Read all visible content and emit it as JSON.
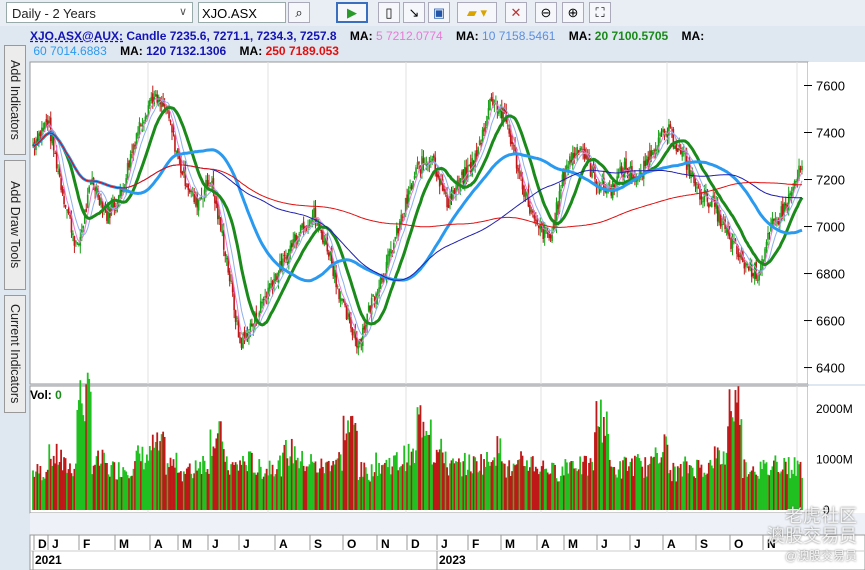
{
  "toolbar": {
    "period": "Daily - 2 Years",
    "symbol": "XJO.ASX",
    "icons": [
      "search-icon",
      "play-icon",
      "new-icon",
      "export-icon",
      "save-icon",
      "open-folder-icon",
      "tools-icon",
      "zoom-out-icon",
      "zoom-in-icon",
      "fit-icon"
    ]
  },
  "side_tabs": [
    "Add Indicators",
    "Add Draw Tools",
    "Current Indicators"
  ],
  "info": {
    "series": "XJO.ASX@AUX:",
    "candle": "Candle 7235.6, 7271.1, 7234.3, 7257.8",
    "ma": [
      {
        "label": "MA:",
        "value": "5 7212.0774",
        "color": "#e879d6"
      },
      {
        "label": "MA:",
        "value": "10 7158.5461",
        "color": "#5b8fe0"
      },
      {
        "label": "MA:",
        "value": "20 7100.5705",
        "color": "#1a8a1a"
      },
      {
        "label": "MA:",
        "value": "60 7014.6883",
        "color": "#2a9af0"
      },
      {
        "label": "MA:",
        "value": "120 7132.1306",
        "color": "#1414b4"
      },
      {
        "label": "MA:",
        "value": "250 7189.053",
        "color": "#e01010"
      }
    ]
  },
  "volume_label": "Vol:",
  "volume_value": "0",
  "watermark": [
    "老虎社区",
    "澳股交易员",
    "@澳股交易员"
  ],
  "chart_data": {
    "type": "candlestick",
    "price_ticks": [
      6400,
      6600,
      6800,
      7000,
      7200,
      7400,
      7600
    ],
    "ylim": [
      6330,
      7700
    ],
    "volume_ticks": [
      "0",
      "1000M",
      "2000M"
    ],
    "volume_ylim": [
      0,
      2400
    ],
    "months": [
      "D",
      "J",
      "F",
      "M",
      "A",
      "M",
      "J",
      "J",
      "A",
      "S",
      "O",
      "N",
      "D",
      "J",
      "F",
      "M",
      "A",
      "M",
      "J",
      "J",
      "A",
      "S",
      "O",
      "N"
    ],
    "years": [
      "2021",
      "2023"
    ],
    "closes_biweekly": [
      7350,
      7450,
      7150,
      6900,
      7200,
      7050,
      7150,
      7400,
      7550,
      7500,
      7250,
      7100,
      7200,
      6900,
      6500,
      6600,
      6750,
      6850,
      7000,
      7050,
      6900,
      6650,
      6500,
      6700,
      6850,
      7050,
      7250,
      7300,
      7100,
      7200,
      7300,
      7550,
      7450,
      7200,
      7000,
      6950,
      7250,
      7350,
      7200,
      7150,
      7250,
      7200,
      7350,
      7400,
      7300,
      7150,
      7100,
      6950,
      6850,
      6800,
      7000,
      7100,
      7257.8
    ],
    "volume_biweekly_M": [
      800,
      1100,
      900,
      2300,
      1000,
      850,
      900,
      1100,
      1300,
      950,
      800,
      1000,
      1500,
      900,
      1000,
      850,
      950,
      1200,
      1000,
      900,
      1050,
      1700,
      800,
      950,
      1000,
      1100,
      1900,
      1200,
      900,
      950,
      1000,
      1250,
      850,
      1000,
      900,
      800,
      1000,
      900,
      1900,
      850,
      950,
      900,
      1300,
      800,
      900,
      900,
      1100,
      2200,
      900,
      850,
      1000,
      900,
      1000
    ]
  }
}
